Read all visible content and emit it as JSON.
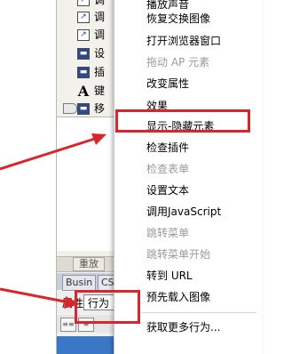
{
  "behaviors": {
    "items": [
      {
        "label": "调",
        "icon": "checkbox-icon"
      },
      {
        "label": "调",
        "icon": "checkbox-icon"
      },
      {
        "label": "调",
        "icon": "checkbox-icon"
      },
      {
        "label": "设",
        "icon": "window-icon"
      },
      {
        "label": "插",
        "icon": "window-icon"
      },
      {
        "label": "键",
        "icon": "letter-a-icon"
      },
      {
        "label": "移",
        "icon": "window-icon"
      }
    ]
  },
  "panel": {
    "replay_label": "重放",
    "tabs": [
      "Busin",
      "CS"
    ],
    "property_label": "属性",
    "property_value": "行为"
  },
  "menu": {
    "items": [
      {
        "label": "播放声音",
        "disabled": false
      },
      {
        "label": "恢复交换图像",
        "disabled": false
      },
      {
        "label": "打开浏览器窗口",
        "disabled": false
      },
      {
        "label": "拖动 AP 元素",
        "disabled": true
      },
      {
        "label": "改变属性",
        "disabled": false
      },
      {
        "label": "效果",
        "disabled": false
      },
      {
        "label": "显示-隐藏元素",
        "disabled": false,
        "highlighted": true
      },
      {
        "label": "检查插件",
        "disabled": false
      },
      {
        "label": "检查表单",
        "disabled": true
      },
      {
        "label": "设置文本",
        "disabled": false
      },
      {
        "label": "调用JavaScript",
        "disabled": false
      },
      {
        "label": "跳转菜单",
        "disabled": true
      },
      {
        "label": "跳转菜单开始",
        "disabled": true
      },
      {
        "label": "转到 URL",
        "disabled": false
      },
      {
        "label": "预先载入图像",
        "disabled": false
      },
      {
        "label": "获取更多行为...",
        "disabled": false
      }
    ]
  },
  "colors": {
    "annotation_red": "#d8262c",
    "disabled_text": "#9a9a9a"
  }
}
